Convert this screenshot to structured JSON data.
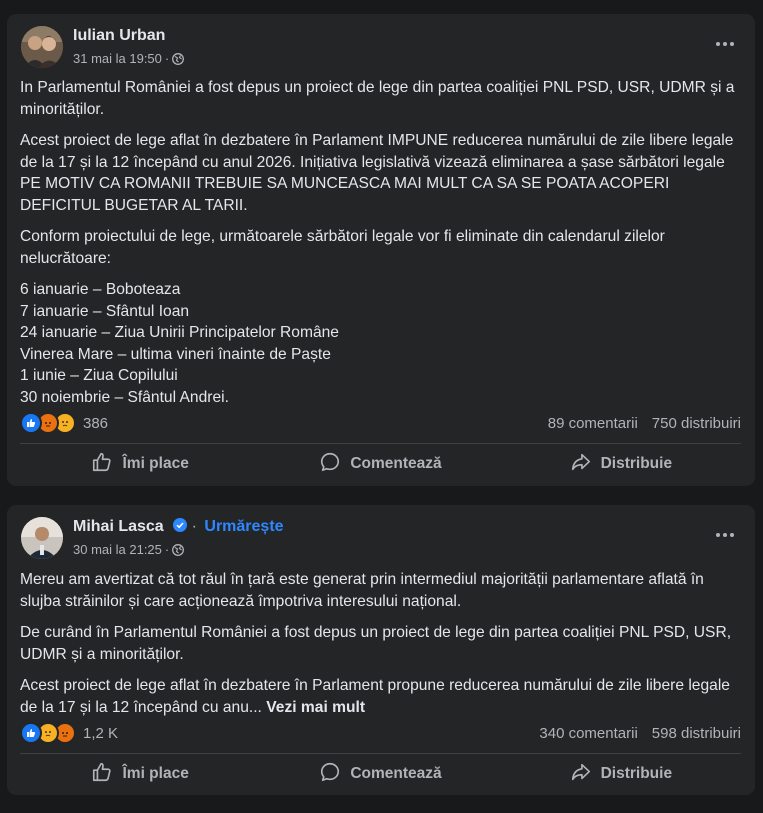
{
  "posts": [
    {
      "author": "Iulian Urban",
      "timestamp": "31 mai la 19:50",
      "paragraphs": [
        "In Parlamentul României a fost depus un proiect de lege din partea coaliției PNL PSD, USR, UDMR și a minorităților.",
        "Acest proiect de lege aflat în dezbatere în Parlament IMPUNE reducerea numărului de zile libere legale de la 17 și la 12 începând cu anul 2026. Inițiativa legislativă vizează eliminarea a șase sărbători legale PE MOTIV CA ROMANII TREBUIE SA MUNCEASCA MAI MULT CA SA SE POATA ACOPERI DEFICITUL BUGETAR AL TARII.",
        "Conform proiectului de lege, următoarele sărbători legale vor fi eliminate din calendarul zilelor nelucrătoare:"
      ],
      "list": [
        "6 ianuarie – Boboteaza",
        "7 ianuarie – Sfântul Ioan",
        "24 ianuarie – Ziua Unirii Principatelor Române",
        "Vinerea Mare – ultima vineri înainte de Paște",
        "1 iunie – Ziua Copilului",
        "30 noiembrie – Sfântul Andrei."
      ],
      "reaction_count": "386",
      "comments": "89 comentarii",
      "shares": "750 distribuiri"
    },
    {
      "author": "Mihai Lasca",
      "follow": "Urmărește",
      "separator": "·",
      "timestamp": "30 mai la 21:25",
      "paragraphs": [
        "Mereu am avertizat că tot răul în țară este generat prin intermediul majorității parlamentare aflată în slujba străinilor și care acționează împotriva interesului național.",
        "De curând în Parlamentul României a fost depus un proiect de lege din partea coaliției PNL PSD, USR, UDMR și a minorităților."
      ],
      "truncated": "Acest proiect de lege aflat în dezbatere în Parlament propune reducerea numărului de zile libere legale de la 17 și la 12 începând cu anu...",
      "see_more": "Vezi mai mult",
      "reaction_count": "1,2 K",
      "comments": "340 comentarii",
      "shares": "598 distribuiri"
    }
  ],
  "actions": {
    "like": "Îmi place",
    "comment": "Comentează",
    "share": "Distribuie"
  },
  "icons": {
    "more": "more-horizontal-icon",
    "globe": "globe-icon",
    "like": "thumbs-up-icon",
    "comment": "speech-bubble-icon",
    "share": "share-arrow-icon",
    "verified": "verified-badge-icon"
  },
  "colors": {
    "background": "#18191a",
    "card": "#242526",
    "text_primary": "#e4e6eb",
    "text_secondary": "#b0b3b8",
    "link_blue": "#2d88ff",
    "like_blue": "#1877f2"
  }
}
